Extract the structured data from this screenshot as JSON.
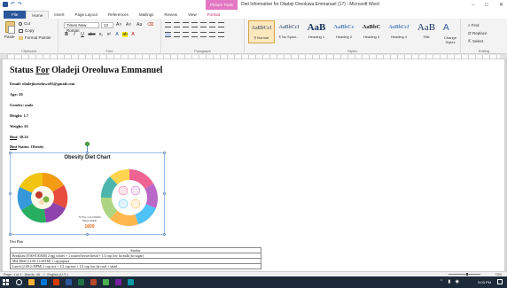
{
  "titlebar": {
    "context_tool": "Picture Tools",
    "doc_title": "Diet Information for Oladeji Oreoluwa Emmanuel (17) - Microsoft Word",
    "minimize": "−",
    "maximize": "□",
    "close": "✕"
  },
  "tabs": [
    {
      "label": "File"
    },
    {
      "label": "Home"
    },
    {
      "label": "Insert"
    },
    {
      "label": "Page Layout"
    },
    {
      "label": "References"
    },
    {
      "label": "Mailings"
    },
    {
      "label": "Review"
    },
    {
      "label": "View"
    },
    {
      "label": "Format"
    }
  ],
  "ribbon": {
    "clipboard": {
      "paste": "Paste",
      "cut": "Cut",
      "copy": "Copy",
      "format_painter": "Format Painter",
      "label": "Clipboard"
    },
    "font": {
      "family": "Times New Roman",
      "size": "12",
      "label": "Font",
      "bold": "B",
      "italic": "I",
      "underline": "U",
      "strike": "abe",
      "sub": "x₂",
      "sup": "x²"
    },
    "paragraph": {
      "label": "Paragraph"
    },
    "styles": {
      "label": "Styles",
      "items": [
        {
          "sample": "AaBbCcI",
          "name": "¶ Normal"
        },
        {
          "sample": "AaBbCcI",
          "name": "¶ No Spaci..."
        },
        {
          "sample": "AaB",
          "name": "Heading 1"
        },
        {
          "sample": "AaBbCc",
          "name": "Heading 2"
        },
        {
          "sample": "AaBbC",
          "name": "Heading 3"
        },
        {
          "sample": "AaBbCcI",
          "name": "Heading 4"
        },
        {
          "sample": "AaB",
          "name": "Title"
        }
      ],
      "change_styles": "Change Styles"
    },
    "editing": {
      "find": "Find",
      "replace": "Replace",
      "select": "Select",
      "label": "Editing"
    }
  },
  "document": {
    "heading_prefix": "Status ",
    "heading_for": "For",
    "heading_name": " Oladeji Oreoluwa Emmanuel",
    "email": "Email: oladejioreoluwa01@gmail.com",
    "age": "Age: 50",
    "gender": "Gender: male",
    "height": "Height: 1.7",
    "weight": "Weight: 65",
    "bmi_label": "Bmi",
    "bmi_value": ": 38.24",
    "bmi_status_label": "Bmi",
    "bmi_status_value": " Status: Obesity",
    "image": {
      "title": "Obesity Diet Chart",
      "total_calories_label": "TOTAL CALORIES REQUIRED",
      "total_calories_value": "1600"
    },
    "diet_plan_label": "Diet Plan",
    "table": {
      "header": "Sunday",
      "rows": [
        "Breakfast (8:00-8:30AM)      2 egg whites + 1 toasted brown bread + 1/2 cup low fat milk (no sugar)",
        "Mid-Meal (11:00-11:30AM)     1 cup papaya",
        "Lunch (2:00-2:30PM)          1 cup rice + 1/2 cup moi + 1/2 cup low fat curd + salad"
      ]
    }
  },
  "statusbar": {
    "page": "Page: 1 of 1",
    "words": "Words: 48",
    "lang": "English (U.S.)",
    "zoom": "73%"
  },
  "taskbar": {
    "time": "9:03 PM",
    "date": "6/2/2023"
  }
}
